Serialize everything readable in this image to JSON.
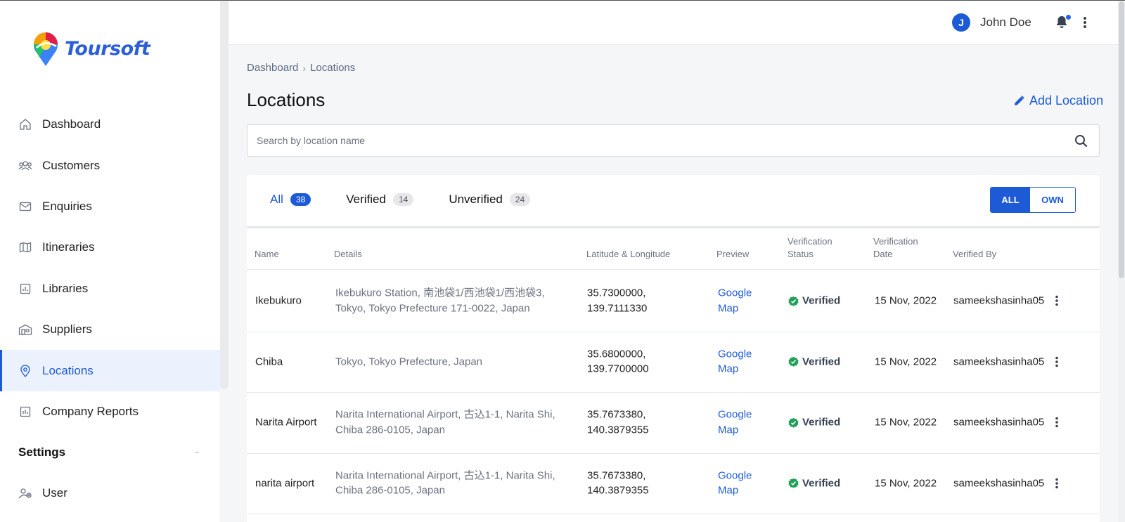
{
  "brand": {
    "name": "Toursoft"
  },
  "sidebar": {
    "items": [
      {
        "label": "Dashboard",
        "icon": "home-icon"
      },
      {
        "label": "Customers",
        "icon": "users-icon"
      },
      {
        "label": "Enquiries",
        "icon": "mail-icon"
      },
      {
        "label": "Itineraries",
        "icon": "map-icon"
      },
      {
        "label": "Libraries",
        "icon": "chart-icon"
      },
      {
        "label": "Suppliers",
        "icon": "building-icon"
      },
      {
        "label": "Locations",
        "icon": "pin-icon",
        "active": true
      },
      {
        "label": "Company Reports",
        "icon": "report-icon"
      }
    ],
    "settings_heading": "Settings",
    "settings_items": [
      {
        "label": "User",
        "icon": "user-gear-icon"
      }
    ]
  },
  "topbar": {
    "user_initial": "J",
    "user_name": "John Doe"
  },
  "breadcrumb": {
    "root": "Dashboard",
    "current": "Locations"
  },
  "page": {
    "title": "Locations",
    "add_label": "Add Location"
  },
  "search": {
    "placeholder": "Search by location name",
    "value": ""
  },
  "tabs": [
    {
      "label": "All",
      "count": "38",
      "active": true
    },
    {
      "label": "Verified",
      "count": "14"
    },
    {
      "label": "Unverified",
      "count": "24"
    }
  ],
  "filter_toggle": {
    "all": "ALL",
    "own": "OWN",
    "selected": "ALL"
  },
  "table": {
    "headers": {
      "name": "Name",
      "details": "Details",
      "latlng": "Latitude & Longitude",
      "preview": "Preview",
      "status_1": "Verification",
      "status_2": "Status",
      "date_1": "Verification",
      "date_2": "Date",
      "verified_by": "Verified By"
    },
    "rows": [
      {
        "name": "Ikebukuro",
        "details": "Ikebukuro Station, 南池袋1/西池袋1/西池袋3, Tokyo, Tokyo Prefecture 171-0022, Japan",
        "lat": "35.7300000,",
        "lng": "139.7111330",
        "preview": "Google Map",
        "status": "Verified",
        "date": "15 Nov, 2022",
        "verified_by": "sameekshasinha05"
      },
      {
        "name": "Chiba",
        "details": "Tokyo, Tokyo Prefecture, Japan",
        "lat": "35.6800000,",
        "lng": "139.7700000",
        "preview": "Google Map",
        "status": "Verified",
        "date": "15 Nov, 2022",
        "verified_by": "sameekshasinha05"
      },
      {
        "name": "Narita Airport",
        "details": "Narita International Airport, 古込1-1, Narita Shi, Chiba 286-0105, Japan",
        "lat": "35.7673380,",
        "lng": "140.3879355",
        "preview": "Google Map",
        "status": "Verified",
        "date": "15 Nov, 2022",
        "verified_by": "sameekshasinha05"
      },
      {
        "name": "narita airport",
        "details": "Narita International Airport, 古込1-1, Narita Shi, Chiba 286-0105, Japan",
        "lat": "35.7673380,",
        "lng": "140.3879355",
        "preview": "Google Map",
        "status": "Verified",
        "date": "15 Nov, 2022",
        "verified_by": "sameekshasinha05"
      }
    ]
  },
  "colors": {
    "accent": "#1d5bd6",
    "verified": "#22a05a"
  }
}
